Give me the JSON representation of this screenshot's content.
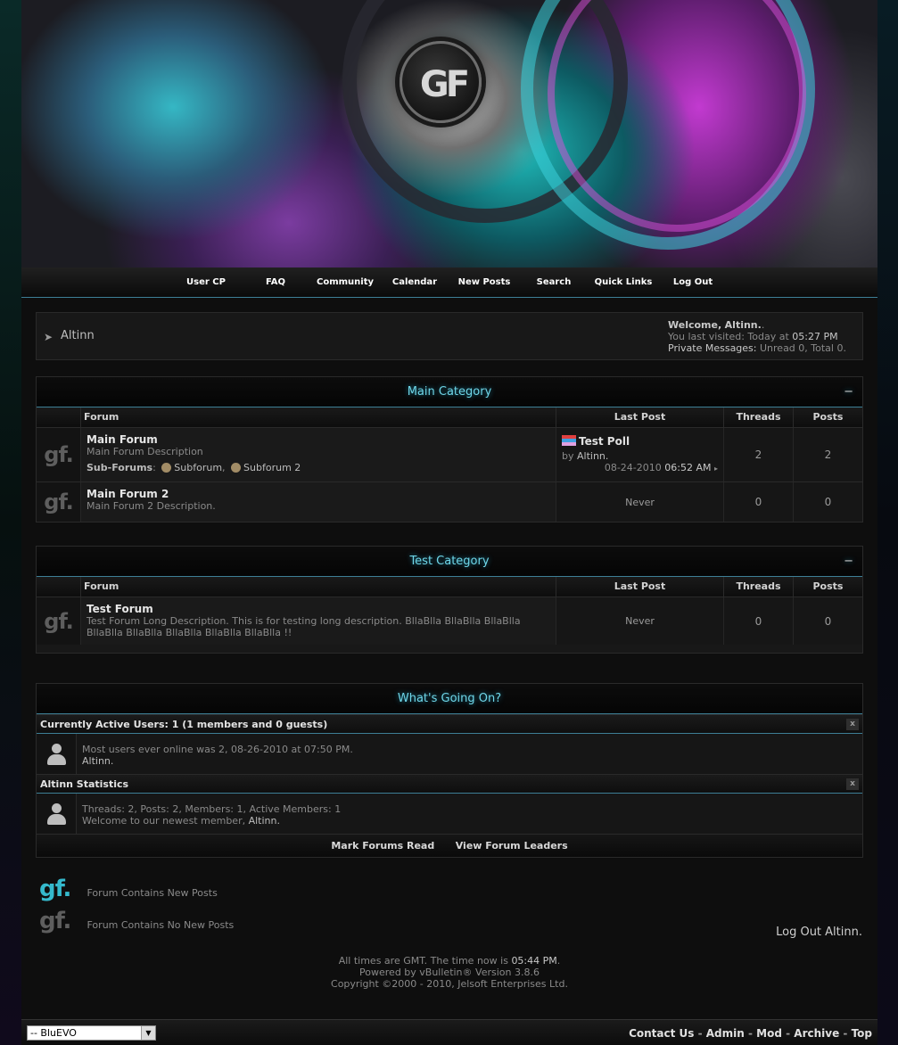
{
  "header": {
    "logo_text": "GF"
  },
  "navbar": {
    "links": [
      "User CP",
      "FAQ",
      "Community",
      "Calendar",
      "New Posts",
      "Search",
      "Quick Links",
      "Log Out"
    ]
  },
  "breadcrumb": {
    "title": "Altinn"
  },
  "welcome": {
    "greeting": "Welcome,",
    "username": "Altinn.",
    "last_visited_label": "You last visited: Today at",
    "last_visited_time": "05:27 PM",
    "pm_label": "Private Messages:",
    "pm_value": "Unread 0, Total 0."
  },
  "columns": {
    "forum": "Forum",
    "last_post": "Last Post",
    "threads": "Threads",
    "posts": "Posts"
  },
  "categories": [
    {
      "title": "Main Category",
      "collapse": "−",
      "forums": [
        {
          "title": "Main Forum",
          "description": "Main Forum Description",
          "subforums_label": "Sub-Forums",
          "subforums": [
            "Subforum",
            "Subforum 2"
          ],
          "last_post": {
            "title": "Test Poll",
            "by": "by",
            "user": "Altinn.",
            "date": "08-24-2010",
            "time": "06:52 AM"
          },
          "threads": "2",
          "posts": "2"
        },
        {
          "title": "Main Forum 2",
          "description": "Main Forum 2 Description.",
          "last_post_text": "Never",
          "threads": "0",
          "posts": "0"
        }
      ]
    },
    {
      "title": "Test Category",
      "collapse": "−",
      "forums": [
        {
          "title": "Test Forum",
          "description": "Test Forum Long Description. This is for testing long description. BllaBlla BllaBlla BllaBlla BllaBlla BllaBlla BllaBlla BllaBlla BllaBlla !!",
          "last_post_text": "Never",
          "threads": "0",
          "posts": "0"
        }
      ]
    }
  ],
  "whats_going_on": {
    "title": "What's Going On?",
    "active_users": {
      "heading": "Currently Active Users: 1 (1 members and 0 guests)",
      "line1": "Most users ever online was 2, 08-26-2010 at 07:50 PM.",
      "line2": "Altinn."
    },
    "statistics": {
      "heading": "Altinn Statistics",
      "line1": "Threads: 2, Posts: 2, Members: 1, Active Members: 1",
      "line2_prefix": "Welcome to our newest member,",
      "line2_user": "Altinn."
    },
    "close": "x",
    "footer_links": [
      "Mark Forums Read",
      "View Forum Leaders"
    ]
  },
  "legend": {
    "icon_text": "gf.",
    "new_posts": "Forum Contains New Posts",
    "no_new_posts": "Forum Contains No New Posts"
  },
  "logout_link": "Log Out Altinn.",
  "footer": {
    "time_prefix": "All times are GMT. The time now is",
    "time_now": "05:44 PM",
    "powered": "Powered by vBulletin® Version 3.8.6",
    "copyright": "Copyright ©2000 - 2010, Jelsoft Enterprises Ltd."
  },
  "bottom": {
    "style_select": "-- BluEVO",
    "links": [
      "Contact Us",
      "Admin",
      "Mod",
      "Archive",
      "Top"
    ]
  },
  "colors": {
    "accent": "#6fd6e8",
    "divider": "#3d7f96",
    "new_icon": "#35b9cc"
  }
}
